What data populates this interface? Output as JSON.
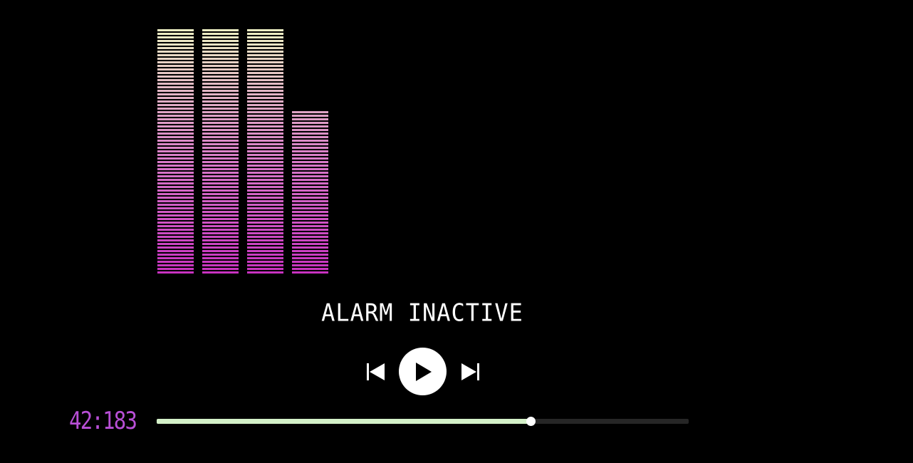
{
  "equalizer": {
    "levels": [
      1.0,
      1.0,
      1.0,
      0.665
    ],
    "gradient_colors": [
      "#c832c0",
      "#d878c8",
      "#e2b6c4",
      "#eef2c4"
    ]
  },
  "status": {
    "text": "ALARM INACTIVE"
  },
  "controls": {
    "prev_icon": "skip-previous-icon",
    "play_icon": "play-icon",
    "next_icon": "skip-next-icon"
  },
  "playback": {
    "time": "42:183",
    "progress": 0.703,
    "progress_color": "#d4f0c8",
    "time_color": "#b84fd6"
  }
}
